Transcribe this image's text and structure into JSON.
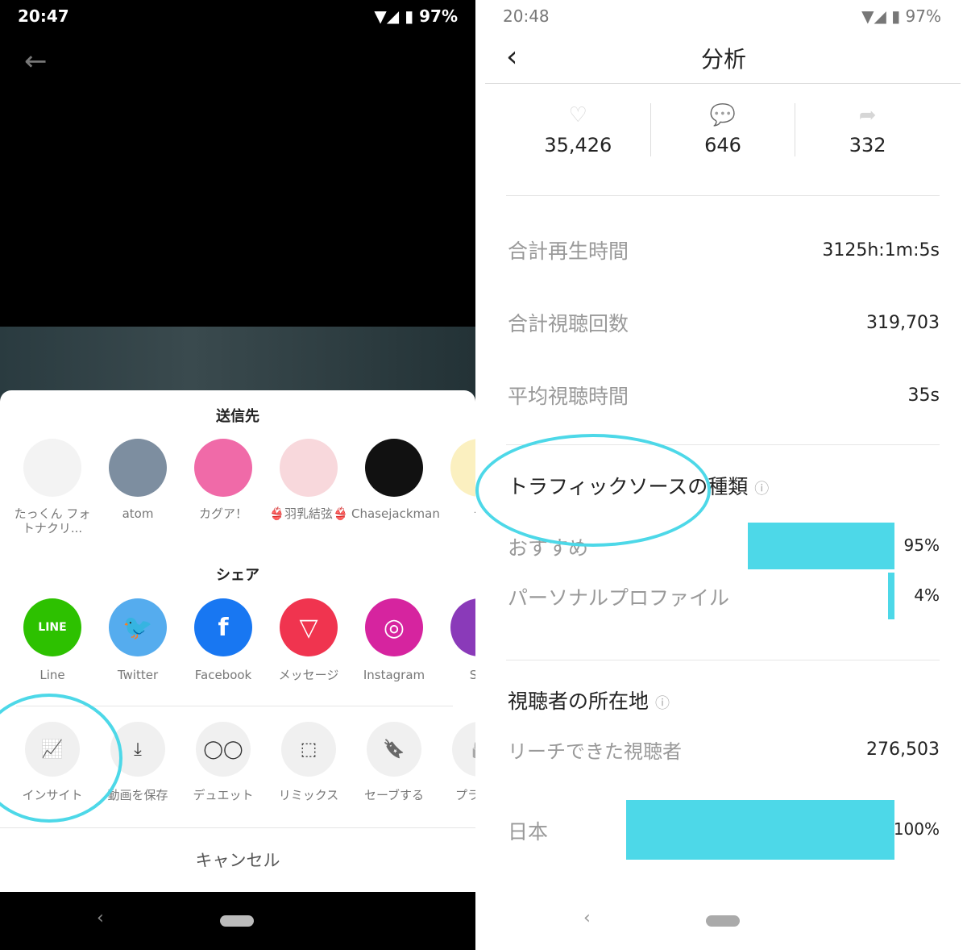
{
  "left": {
    "status": {
      "time": "20:47",
      "battery": "97%"
    },
    "send_title": "送信先",
    "contacts": [
      {
        "name": "たっくん フォトナクリ..."
      },
      {
        "name": "atom"
      },
      {
        "name": "カグア！"
      },
      {
        "name": "👙羽乳結弦👙"
      },
      {
        "name": "Chasejackman"
      },
      {
        "name": "テ"
      }
    ],
    "share_title": "シェア",
    "share": [
      {
        "name": "Line",
        "icon": "line-icon",
        "color": "#2dc100",
        "glyph": "LINE"
      },
      {
        "name": "Twitter",
        "icon": "twitter-icon",
        "color": "#55acee",
        "glyph": "🐦"
      },
      {
        "name": "Facebook",
        "icon": "facebook-icon",
        "color": "#1877f2",
        "glyph": "f"
      },
      {
        "name": "メッセージ",
        "icon": "message-icon",
        "color": "#f0344f",
        "glyph": "▽"
      },
      {
        "name": "Instagram",
        "icon": "instagram-icon",
        "color": "#d6249f",
        "glyph": "◎"
      },
      {
        "name": "Sto",
        "icon": "story-icon",
        "color": "#8a3ab9",
        "glyph": ""
      }
    ],
    "actions": [
      {
        "name": "インサイト",
        "icon": "insights-chart-icon",
        "glyph": "📈"
      },
      {
        "name": "動画を保存",
        "icon": "download-icon",
        "glyph": "⤓"
      },
      {
        "name": "デュエット",
        "icon": "duet-icon",
        "glyph": "◯◯"
      },
      {
        "name": "リミックス",
        "icon": "remix-icon",
        "glyph": "⬚"
      },
      {
        "name": "セーブする",
        "icon": "bookmark-icon",
        "glyph": "🔖"
      },
      {
        "name": "プライ一",
        "icon": "lock-icon",
        "glyph": "🔒"
      }
    ],
    "cancel": "キャンセル"
  },
  "right": {
    "status": {
      "time": "20:48",
      "battery": "97%"
    },
    "title": "分析",
    "stats": [
      {
        "icon": "heart-icon",
        "value": "35,426"
      },
      {
        "icon": "comment-icon",
        "value": "646"
      },
      {
        "icon": "share-icon",
        "value": "332"
      }
    ],
    "metrics": [
      {
        "label": "合計再生時間",
        "value": "3125h:1m:5s"
      },
      {
        "label": "合計視聴回数",
        "value": "319,703"
      },
      {
        "label": "平均視聴時間",
        "value": "35s"
      }
    ],
    "traffic_title": "トラフィックソースの種類",
    "traffic": [
      {
        "label": "おすすめ",
        "pct": 95,
        "value": "95%"
      },
      {
        "label": "パーソナルプロファイル",
        "pct": 4,
        "value": "4%"
      }
    ],
    "location_title": "視聴者の所在地",
    "reach_label": "リーチできた視聴者",
    "reach_value": "276,503",
    "countries": [
      {
        "label": "日本",
        "pct": 100,
        "value": "100%"
      }
    ],
    "accent": "#4dd8e8"
  }
}
